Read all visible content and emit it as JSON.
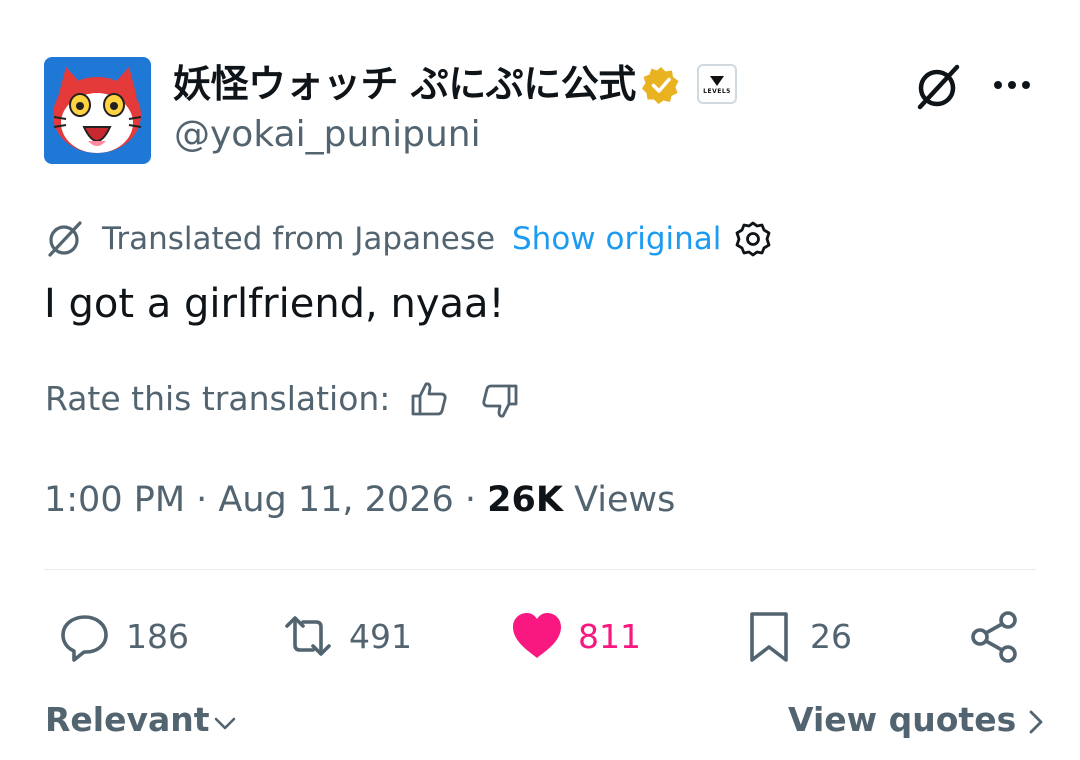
{
  "user": {
    "display_name": "妖怪ウォッチ ぷにぷに公式",
    "handle": "@yokai_punipuni",
    "affiliate_badge_text": "LEVEL5"
  },
  "translation": {
    "label": "Translated from Japanese",
    "show_original": "Show original"
  },
  "tweet": {
    "text": "I got a girlfriend, nyaa!"
  },
  "rate": {
    "label": "Rate this translation:"
  },
  "meta": {
    "time_date": "1:00 PM · Aug 11, 2026 · ",
    "views_count": "26K",
    "views_label": " Views"
  },
  "actions": {
    "replies": "186",
    "reposts": "491",
    "likes": "811",
    "bookmarks": "26"
  },
  "footer": {
    "sort_label": "Relevant",
    "view_quotes": "View quotes"
  },
  "colors": {
    "accent": "#1d9bf0",
    "like": "#f91880",
    "verified": "#e8b220",
    "secondary_text": "#536471"
  }
}
